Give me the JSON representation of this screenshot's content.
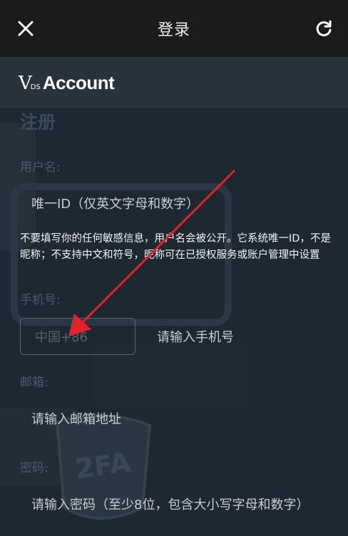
{
  "header": {
    "title": "登录",
    "close_icon": "close-icon",
    "refresh_icon": "refresh-icon"
  },
  "brand": {
    "logo_v": "V",
    "logo_ds": "DS",
    "logo_word": "Account"
  },
  "form": {
    "section_title": "注册",
    "username": {
      "label": "用户名:",
      "placeholder": "唯一ID（仅英文字母和数字）",
      "hint": "不要填写你的任何敏感信息，用户名会被公开。它系统唯一ID，不是昵称；不支持中文和符号，昵称可在已授权服务或账户管理中设置"
    },
    "phone": {
      "label": "手机号:",
      "country": "中国+86",
      "placeholder": "请输入手机号"
    },
    "email": {
      "label": "邮箱:",
      "placeholder": "请输入邮箱地址"
    },
    "password": {
      "label": "密码:",
      "placeholder": "请输入密码（至少8位，包含大小写字母和数字）"
    }
  },
  "decor": {
    "badge_text": "2FA"
  },
  "colors": {
    "topbar": "#1b1b1b",
    "brandbar": "#28323d",
    "content_bg": "#1e2832",
    "annotation_arrow": "#e0242b"
  }
}
